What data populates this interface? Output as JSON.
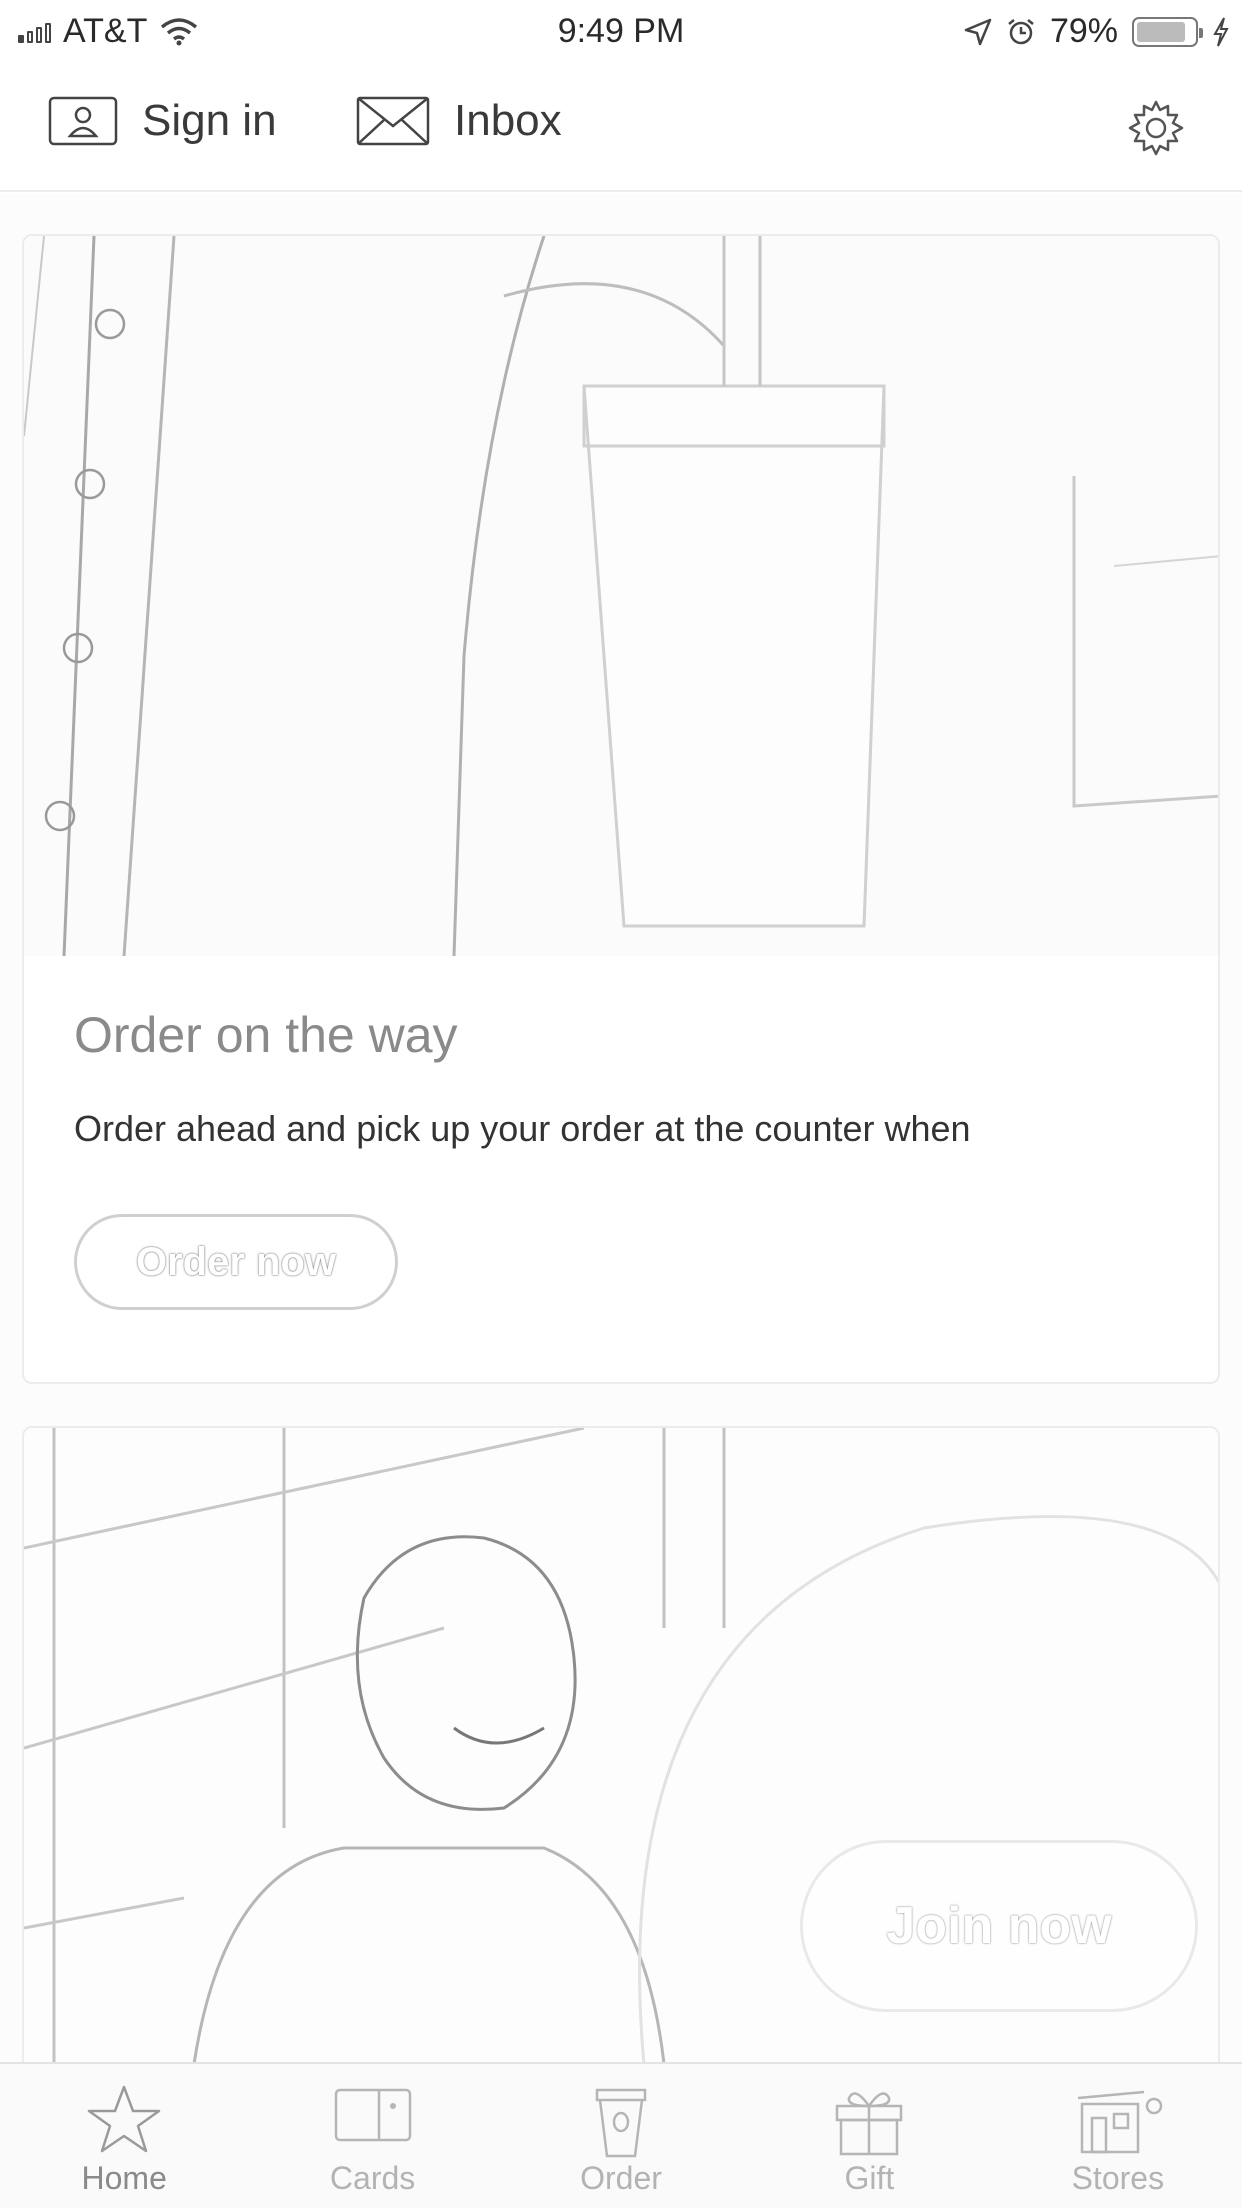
{
  "status_bar": {
    "carrier": "AT&T",
    "time": "9:49 PM",
    "battery": "79%"
  },
  "top_nav": {
    "sign_in_label": "Sign in",
    "inbox_label": "Inbox"
  },
  "cards": [
    {
      "title": "Order on the way",
      "description": "Order ahead and pick up your order at the counter when",
      "button_label": "Order now"
    },
    {
      "button_label": "Join now"
    }
  ],
  "tab_bar": {
    "items": [
      {
        "label": "Home",
        "icon": "star-icon",
        "active": true
      },
      {
        "label": "Cards",
        "icon": "card-icon"
      },
      {
        "label": "Order",
        "icon": "cup-icon"
      },
      {
        "label": "Gift",
        "icon": "gift-icon"
      },
      {
        "label": "Stores",
        "icon": "store-icon"
      }
    ]
  }
}
